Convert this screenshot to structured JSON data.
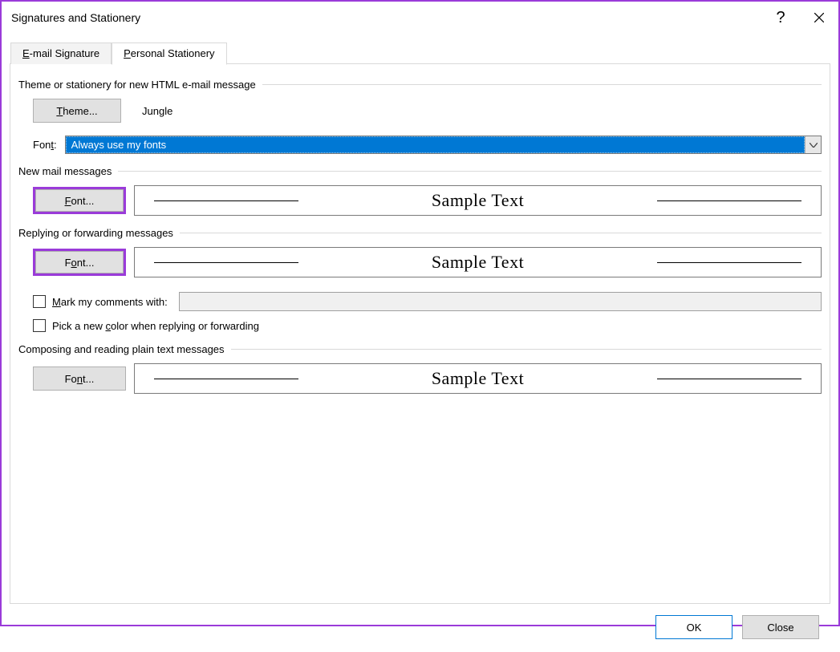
{
  "window": {
    "title": "Signatures and Stationery"
  },
  "tabs": {
    "email_signature": "E-mail Signature",
    "personal_stationery": "Personal Stationery"
  },
  "section": {
    "theme_header": "Theme or stationery for new HTML e-mail message",
    "theme_btn": "Theme...",
    "theme_name": "Jungle",
    "font_label": "Font:",
    "font_value": "Always use my fonts",
    "new_mail_header": "New mail messages",
    "reply_header": "Replying or forwarding messages",
    "plain_header": "Composing and reading plain text messages",
    "font_btn": "Font...",
    "sample": "Sample Text",
    "mark_label": "Mark my comments with:",
    "pick_color_label": "Pick a new color when replying or forwarding"
  },
  "footer": {
    "ok": "OK",
    "close": "Close"
  }
}
